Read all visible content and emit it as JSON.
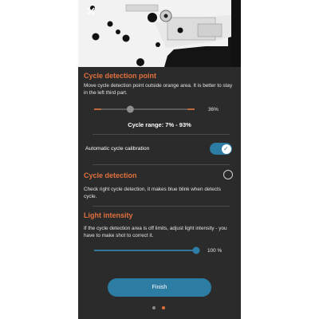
{
  "colors": {
    "accent_orange": "#e0703c",
    "accent_blue": "#2d7ca3",
    "panel_bg": "#2b2b2b",
    "text": "#e6e6e6"
  },
  "header": {
    "close_icon": "close-icon"
  },
  "cycle_point": {
    "title": "Cycle detection point",
    "description": "Move cycle detection point outside orange area. It is better to stay in the left third part.",
    "slider_value_label": "36%",
    "slider_value": 0.36,
    "range_label": "Cycle range: 7% - 93%",
    "range_min": 0.07,
    "range_max": 0.93
  },
  "auto_calibration": {
    "label": "Automatic cycle calibration",
    "enabled": true
  },
  "cycle_detection": {
    "title": "Cycle detection",
    "description": "Check right cycle detection, it makes blue blink when detects cycle.",
    "checked": false
  },
  "light_intensity": {
    "title": "Light intensity",
    "description": "If the cycle detection area is off limits, adjust light intensity - you have to make shot to correct it.",
    "slider_value_label": "100 %",
    "slider_value": 1.0
  },
  "footer": {
    "finish_label": "Finish",
    "page_index": 2,
    "page_count": 2
  }
}
